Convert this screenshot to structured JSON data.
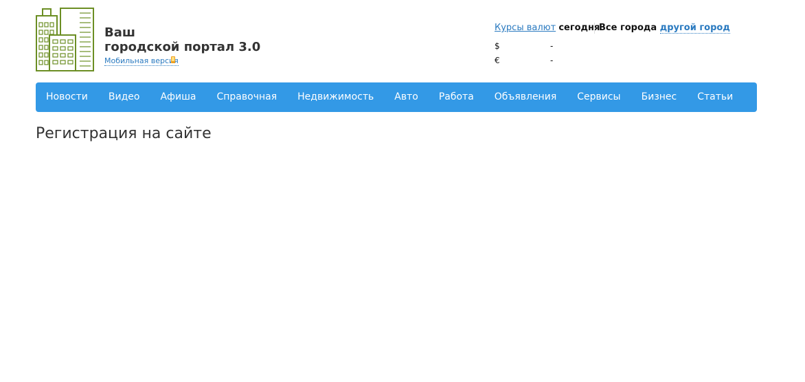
{
  "header": {
    "logo_icon": "city-buildings-icon",
    "logo_color": "#6b8e23",
    "title_line1": "Ваш",
    "title_line2": "городской портал 3.0",
    "mobile_link": "Мобильная версия",
    "mobile_icon": "mobile-phone-icon"
  },
  "rates": {
    "link_label": "Курсы валют",
    "today_label": "сегодня",
    "usd_symbol": "$",
    "usd_value": "-",
    "eur_symbol": "€",
    "eur_value": "-"
  },
  "city": {
    "all_cities_label": "Все города",
    "other_city_link": "другой город"
  },
  "nav": {
    "background": "#3399e6",
    "items": [
      "Новости",
      "Видео",
      "Афиша",
      "Справочная",
      "Недвижимость",
      "Авто",
      "Работа",
      "Объявления",
      "Сервисы",
      "Бизнес",
      "Статьи"
    ]
  },
  "main": {
    "heading": "Регистрация на сайте"
  }
}
